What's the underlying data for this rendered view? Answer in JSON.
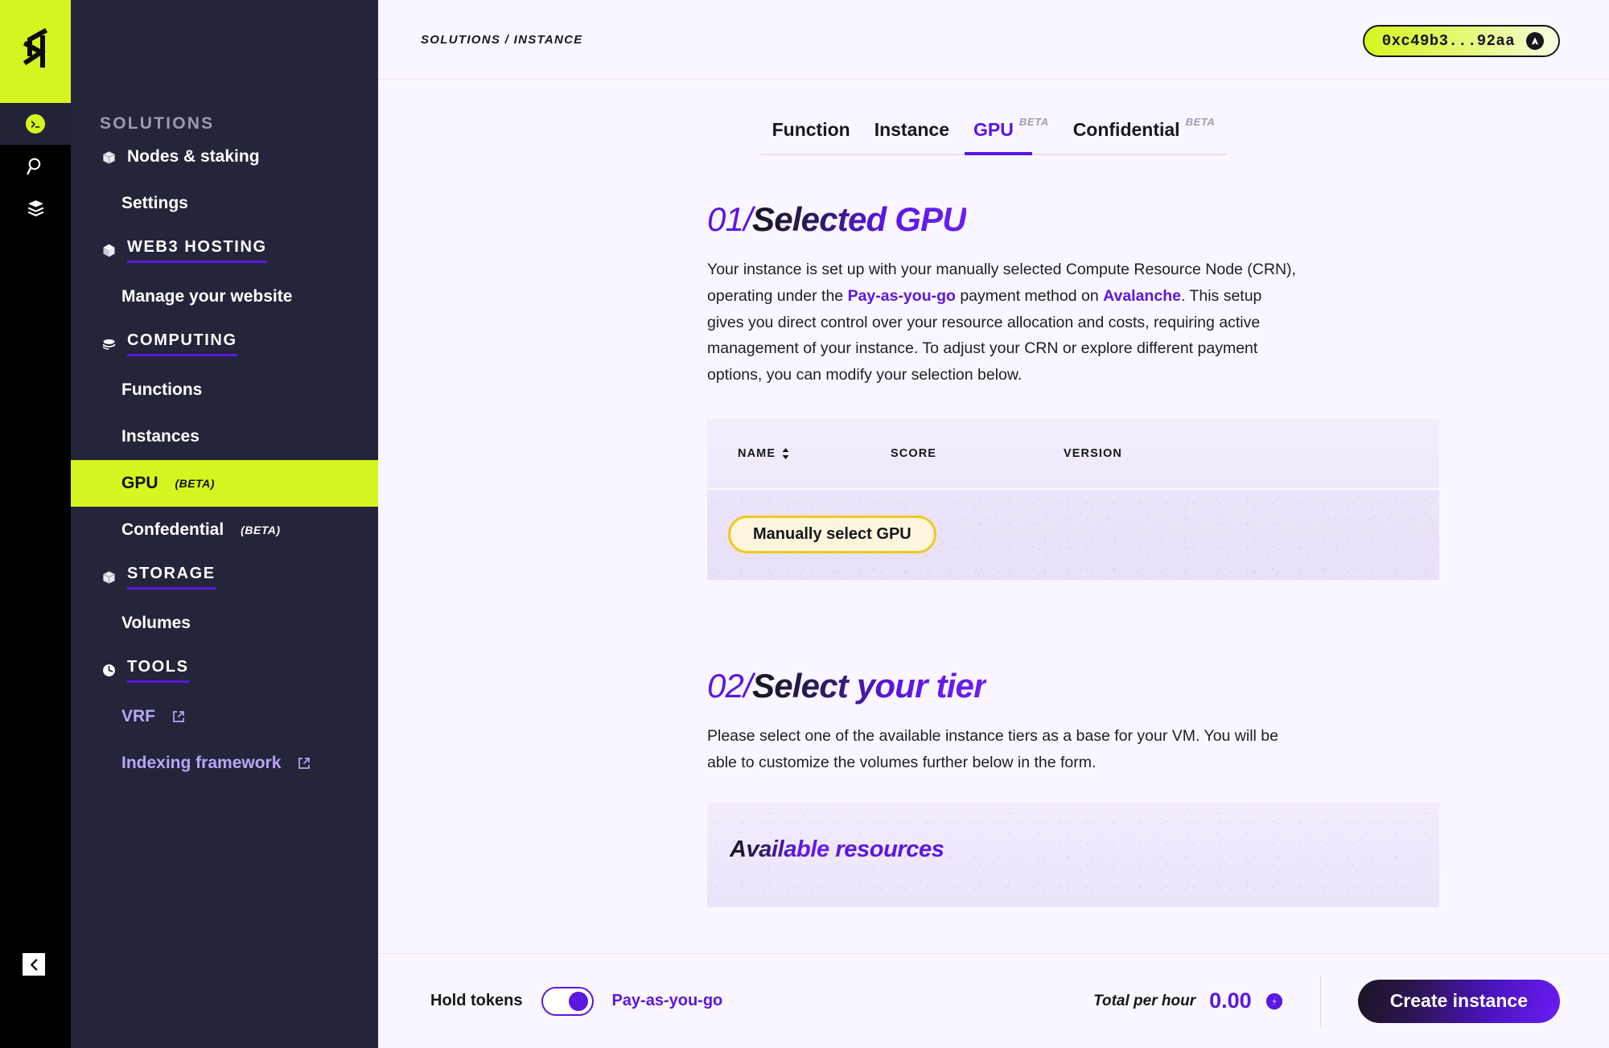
{
  "brand": {
    "logo_alt": "aleph-logo",
    "accent_lime": "#d6f520",
    "accent_purple": "#5a17e0"
  },
  "rail": {
    "avatar_glyph": "⌫",
    "icons": [
      {
        "name": "search-icon"
      },
      {
        "name": "layers-icon"
      }
    ],
    "collapse_glyph": "‹"
  },
  "sidebar": {
    "title": "SOLUTIONS",
    "items": [
      {
        "label": "Nodes & staking",
        "icon": "box-icon",
        "type": "item",
        "indent": false
      },
      {
        "label": "Settings",
        "icon": "",
        "type": "item",
        "indent": true
      },
      {
        "label": "WEB3 HOSTING",
        "icon": "cube-icon",
        "type": "group",
        "indent": false
      },
      {
        "label": "Manage your website",
        "icon": "",
        "type": "item",
        "indent": true
      },
      {
        "label": "COMPUTING",
        "icon": "stack-icon",
        "type": "group",
        "indent": false
      },
      {
        "label": "Functions",
        "icon": "",
        "type": "item",
        "indent": true
      },
      {
        "label": "Instances",
        "icon": "",
        "type": "item",
        "indent": true
      },
      {
        "label": "GPU",
        "badge": "(BETA)",
        "icon": "",
        "type": "item",
        "indent": true,
        "active": true
      },
      {
        "label": "Confedential",
        "badge": "(BETA)",
        "icon": "",
        "type": "item",
        "indent": true
      },
      {
        "label": "STORAGE",
        "icon": "box-icon",
        "type": "group",
        "indent": false
      },
      {
        "label": "Volumes",
        "icon": "",
        "type": "item",
        "indent": true
      },
      {
        "label": "TOOLS",
        "icon": "clock-icon",
        "type": "group",
        "indent": false
      },
      {
        "label": "VRF",
        "icon": "",
        "type": "item",
        "indent": true,
        "external": true
      },
      {
        "label": "Indexing framework",
        "icon": "",
        "type": "item",
        "indent": true,
        "external": true
      }
    ]
  },
  "topbar": {
    "breadcrumb": "SOLUTIONS / INSTANCE",
    "wallet_address": "0xc49b3...92aa",
    "wallet_network_icon": "avalanche-icon"
  },
  "tabs": [
    {
      "label": "Function",
      "beta": "",
      "active": false
    },
    {
      "label": "Instance",
      "beta": "",
      "active": false
    },
    {
      "label": "GPU",
      "beta": "BETA",
      "active": true
    },
    {
      "label": "Confidential",
      "beta": "BETA",
      "active": false
    }
  ],
  "section1": {
    "number": "01/",
    "title": "Selected GPU",
    "paragraph_1": "Your instance is set up with your manually selected Compute Resource Node (CRN), operating under the ",
    "highlight_1": "Pay-as-you-go",
    "paragraph_2": " payment method on ",
    "highlight_2": "Avalanche",
    "paragraph_3": ". This setup gives you direct control over your resource allocation and costs, requiring active management of your instance. To adjust your CRN or explore different payment options, you can modify your selection below.",
    "table": {
      "columns": [
        "NAME",
        "SCORE",
        "VERSION"
      ],
      "sort_column": "NAME",
      "rows": []
    },
    "select_button": "Manually select GPU"
  },
  "section2": {
    "number": "02/",
    "title": "Select your tier",
    "paragraph": "Please select one of the available instance tiers as a base for your VM. You will be able to customize the volumes further below in the form.",
    "resources_title_a": "Available ",
    "resources_title_b": "resources"
  },
  "bottombar": {
    "hold_tokens_label": "Hold tokens",
    "payment_mode_label": "Pay-as-you-go",
    "toggle_state": "on",
    "total_label": "Total per hour",
    "total_value": "0.00",
    "total_currency_icon": "aleph-token-icon",
    "create_button": "Create instance"
  }
}
